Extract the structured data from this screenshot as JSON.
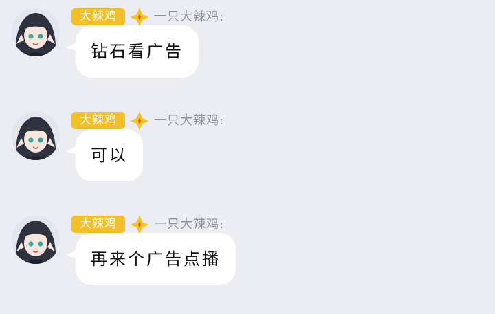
{
  "messages": [
    {
      "badge": "大辣鸡",
      "sender": "一只大辣鸡:",
      "text": "钻石看广告"
    },
    {
      "badge": "大辣鸡",
      "sender": "一只大辣鸡:",
      "text": "可以"
    },
    {
      "badge": "大辣鸡",
      "sender": "一只大辣鸡:",
      "text": "再来个广告点播"
    }
  ],
  "colors": {
    "background": "#ebedf2",
    "badge": "#f3bf27",
    "rank_icon": "#f5c518",
    "rank_icon_center": "#e8541c",
    "nickname": "#8e9097",
    "bubble": "#ffffff"
  },
  "icons": {
    "rank": "diamond-star-icon"
  }
}
